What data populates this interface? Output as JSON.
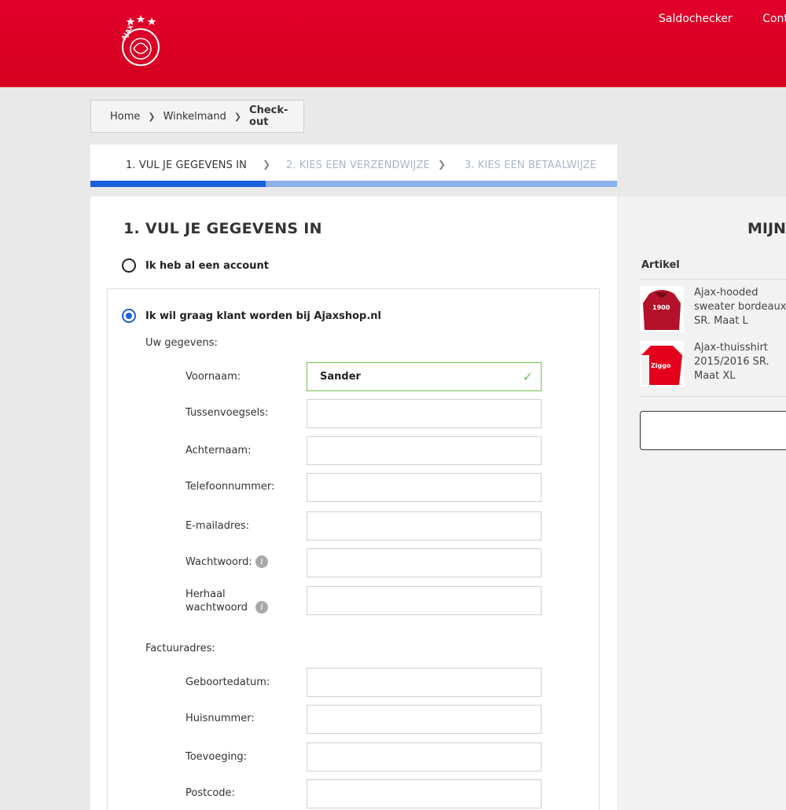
{
  "header": {
    "nav": [
      "Saldochecker",
      "Contact"
    ],
    "logo_text": "AJAX"
  },
  "breadcrumb": {
    "home": "Home",
    "cart": "Winkelmand",
    "current": "Check-out"
  },
  "steps": {
    "step1": "1. VUL JE GEGEVENS IN",
    "step2": "2. KIES EEN VERZENDWIJZE",
    "step3": "3. KIES EEN BETAALWIJZE",
    "progress_fraction": 0.333
  },
  "form": {
    "title": "1. VUL JE GEGEVENS IN",
    "option_existing": "Ik heb al een account",
    "option_new": "Ik wil graag klant worden bij Ajaxshop.nl",
    "section_personal": "Uw gegevens:",
    "section_billing": "Factuuradres:",
    "fields": {
      "voornaam": {
        "label": "Voornaam:",
        "value": "Sander"
      },
      "tussenvoegsels": {
        "label": "Tussenvoegsels:",
        "value": ""
      },
      "achternaam": {
        "label": "Achternaam:",
        "value": ""
      },
      "telefoon": {
        "label": "Telefoonnummer:",
        "value": ""
      },
      "email": {
        "label": "E-mailadres:",
        "value": ""
      },
      "wachtwoord": {
        "label": "Wachtwoord:",
        "value": ""
      },
      "herhaal": {
        "label": "Herhaal wachtwoord",
        "value": ""
      },
      "geboortedatum": {
        "label": "Geboortedatum:",
        "value": ""
      },
      "huisnummer": {
        "label": "Huisnummer:",
        "value": ""
      },
      "toevoeging": {
        "label": "Toevoeging:",
        "value": ""
      },
      "postcode": {
        "label": "Postcode:",
        "value": ""
      }
    }
  },
  "cart": {
    "title": "MIJN",
    "column": "Artikel",
    "items": [
      {
        "name": "Ajax-hooded sweater bordeaux SR. Maat L",
        "thumb_text": "1900"
      },
      {
        "name": "Ajax-thuisshirt 2015/2016 SR. Maat XL",
        "thumb_text": "Ziggo"
      }
    ]
  },
  "colors": {
    "brand_red": "#d5001f",
    "accent_blue": "#1b5fd9",
    "valid_green": "#74c04a"
  }
}
